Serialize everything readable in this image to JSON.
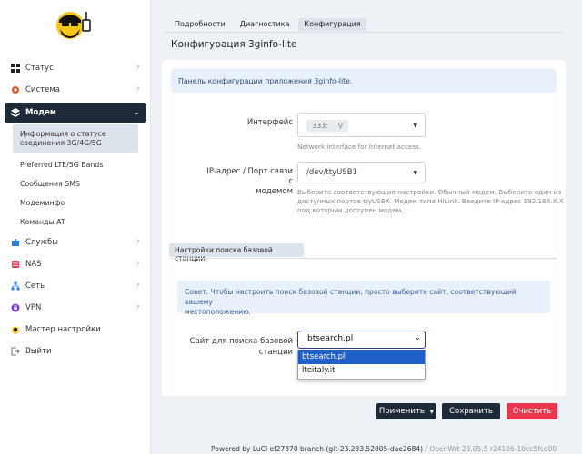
{
  "sidebar": {
    "items": [
      {
        "label": "Статус",
        "icon": "dashboard-icon",
        "color": "#222222"
      },
      {
        "label": "Система",
        "icon": "gear-icon",
        "color": "#e4572e"
      },
      {
        "label": "Модем",
        "icon": "modem-icon",
        "color": "#ffffff"
      },
      {
        "label": "Службы",
        "icon": "puzzle-icon",
        "color": "#2a7de1"
      },
      {
        "label": "NAS",
        "icon": "nas-icon",
        "color": "#e23c5a"
      },
      {
        "label": "Сеть",
        "icon": "network-icon",
        "color": "#2a7de1"
      },
      {
        "label": "VPN",
        "icon": "vpn-icon",
        "color": "#7a3be0"
      },
      {
        "label": "Мастер настройки",
        "icon": "wizard-icon",
        "color": "#222222"
      },
      {
        "label": "Выйти",
        "icon": "logout-icon",
        "color": "#777777"
      }
    ],
    "modem_sub": [
      "Информация о статусе соединения 3G/4G/5G",
      "Preferred LTE/5G Bands",
      "Сообщения SMS",
      "Модеминфо",
      "Команды AT"
    ]
  },
  "tabs": [
    "Подробности",
    "Диагностика",
    "Конфигурация"
  ],
  "page_title": "Конфигурация 3ginfo-lite",
  "info": "Панель конфигурации приложения 3ginfo-lite.",
  "interface": {
    "label": "Интерфейс",
    "value_tag": "333:",
    "help": "Network interface for Internet access."
  },
  "port": {
    "label_line1": "IP-адрес / Порт связи с",
    "label_line2": "модемом",
    "value": "/dev/ttyUSB1",
    "help_line1": "Выберите соответствующие настройки. Обычный модем. Выберите один из",
    "help_line2": "доступных портов ttyUSBX. Модем типа HiLink. Введите IP-адрес 192.168.X.X",
    "help_line3": "под которым доступен модем."
  },
  "section_title": "Настройки поиска базовой станции",
  "tip_line1": "Совет: Чтобы настроить поиск базовой станции, просто выберите сайт, соответствующий вашему",
  "tip_line2": "местоположению.",
  "site": {
    "label_line1": "Сайт для поиска базовой",
    "label_line2": "станции",
    "value": "btsearch.pl",
    "options": [
      "btsearch.pl",
      "lteitaly.it"
    ]
  },
  "buttons": {
    "apply": "Применить",
    "save": "Сохранить",
    "reset": "Очистить"
  },
  "footer": {
    "main": "Powered by LuCI ef27870 branch (git-23.233.52805-dae2684)",
    "sep": " / ",
    "version": "OpenWrt 23.05.5 r24106-10cc5fcd00"
  },
  "colors": {
    "sidebar_active": "#1e2a38",
    "apply_bg": "#1e2a38",
    "save_bg": "#1e2a38",
    "reset_bg": "#e8384f",
    "dropdown_highlight": "#1f5fc7",
    "select_focus": "#2c3e8a"
  }
}
